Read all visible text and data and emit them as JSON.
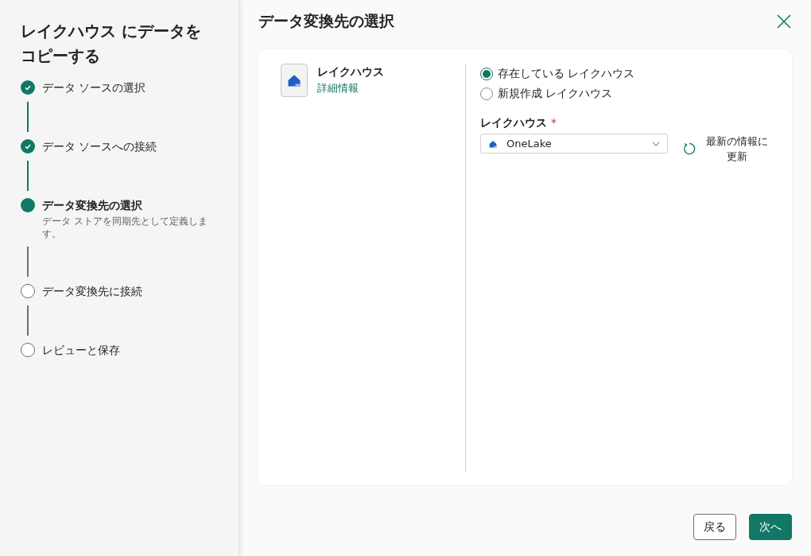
{
  "sidebar": {
    "title": "レイクハウス にデータをコピーする",
    "steps": [
      {
        "label": "データ ソースの選択",
        "completed": true,
        "selected": false
      },
      {
        "label": "データ ソースへの接続",
        "completed": true,
        "selected": false
      },
      {
        "label": "データ変換先の選択",
        "completed": false,
        "selected": true,
        "description": "データ ストアを同期先として定義します。"
      },
      {
        "label": "データ変換先に接続",
        "completed": false,
        "selected": false
      },
      {
        "label": "レビューと保存",
        "completed": false,
        "selected": false
      }
    ]
  },
  "main": {
    "title": "データ変換先の選択",
    "destination": {
      "name": "レイクハウス",
      "link": "詳細情報"
    },
    "options": [
      {
        "label": "存在している レイクハウス",
        "selected": true
      },
      {
        "label": "新規作成 レイクハウス",
        "selected": false
      }
    ],
    "field": {
      "label": "レイクハウス",
      "required_mark": "*",
      "value": "OneLake"
    },
    "refresh": "最新の情報に更新"
  },
  "buttons": [
    {
      "label": "戻る",
      "kind": "secondary"
    },
    {
      "label": "次へ",
      "kind": "primary"
    }
  ]
}
